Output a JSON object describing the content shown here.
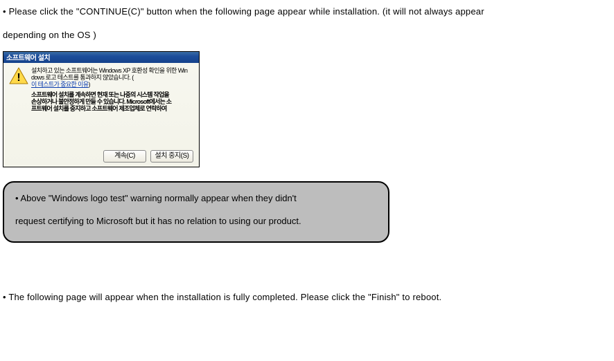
{
  "intro_line1": "• Please click the \"CONTINUE(C)\" button when the following page appear while installation. (it will not always appear",
  "intro_line2": "depending on the OS )",
  "dialog": {
    "title": "소프트웨어 설치",
    "msg_l1": "설치하고 있는 소프트웨어는 Windows XP 호환성 확인을 위한 Win",
    "msg_l2": "dows 로고 테스트를 통과하지 않았습니다. (",
    "msg_link": "이 테스트가 중요한 이유",
    "msg_l3": ")",
    "msg2_l1": "소프트웨어 설치를 계속하면 현재 또는 나중의 시스템 작업을",
    "msg2_l2": "손상하거나 불안정하게 만들 수 있습니다. Microsoft에서는 소",
    "msg2_l3": "프트웨어 설치를 중지하고 소프트웨어 제조업체로 연락하여",
    "btn_continue": "계속(C)",
    "btn_stop": "설치 중지(S)"
  },
  "note_l1": "• Above \"Windows logo test\" warning normally appear when they didn't",
  "note_l2": "request certifying to Microsoft but it has no relation to using our product.",
  "final": "• The following page will appear when the installation is fully completed.    Please click the \"Finish\" to reboot."
}
